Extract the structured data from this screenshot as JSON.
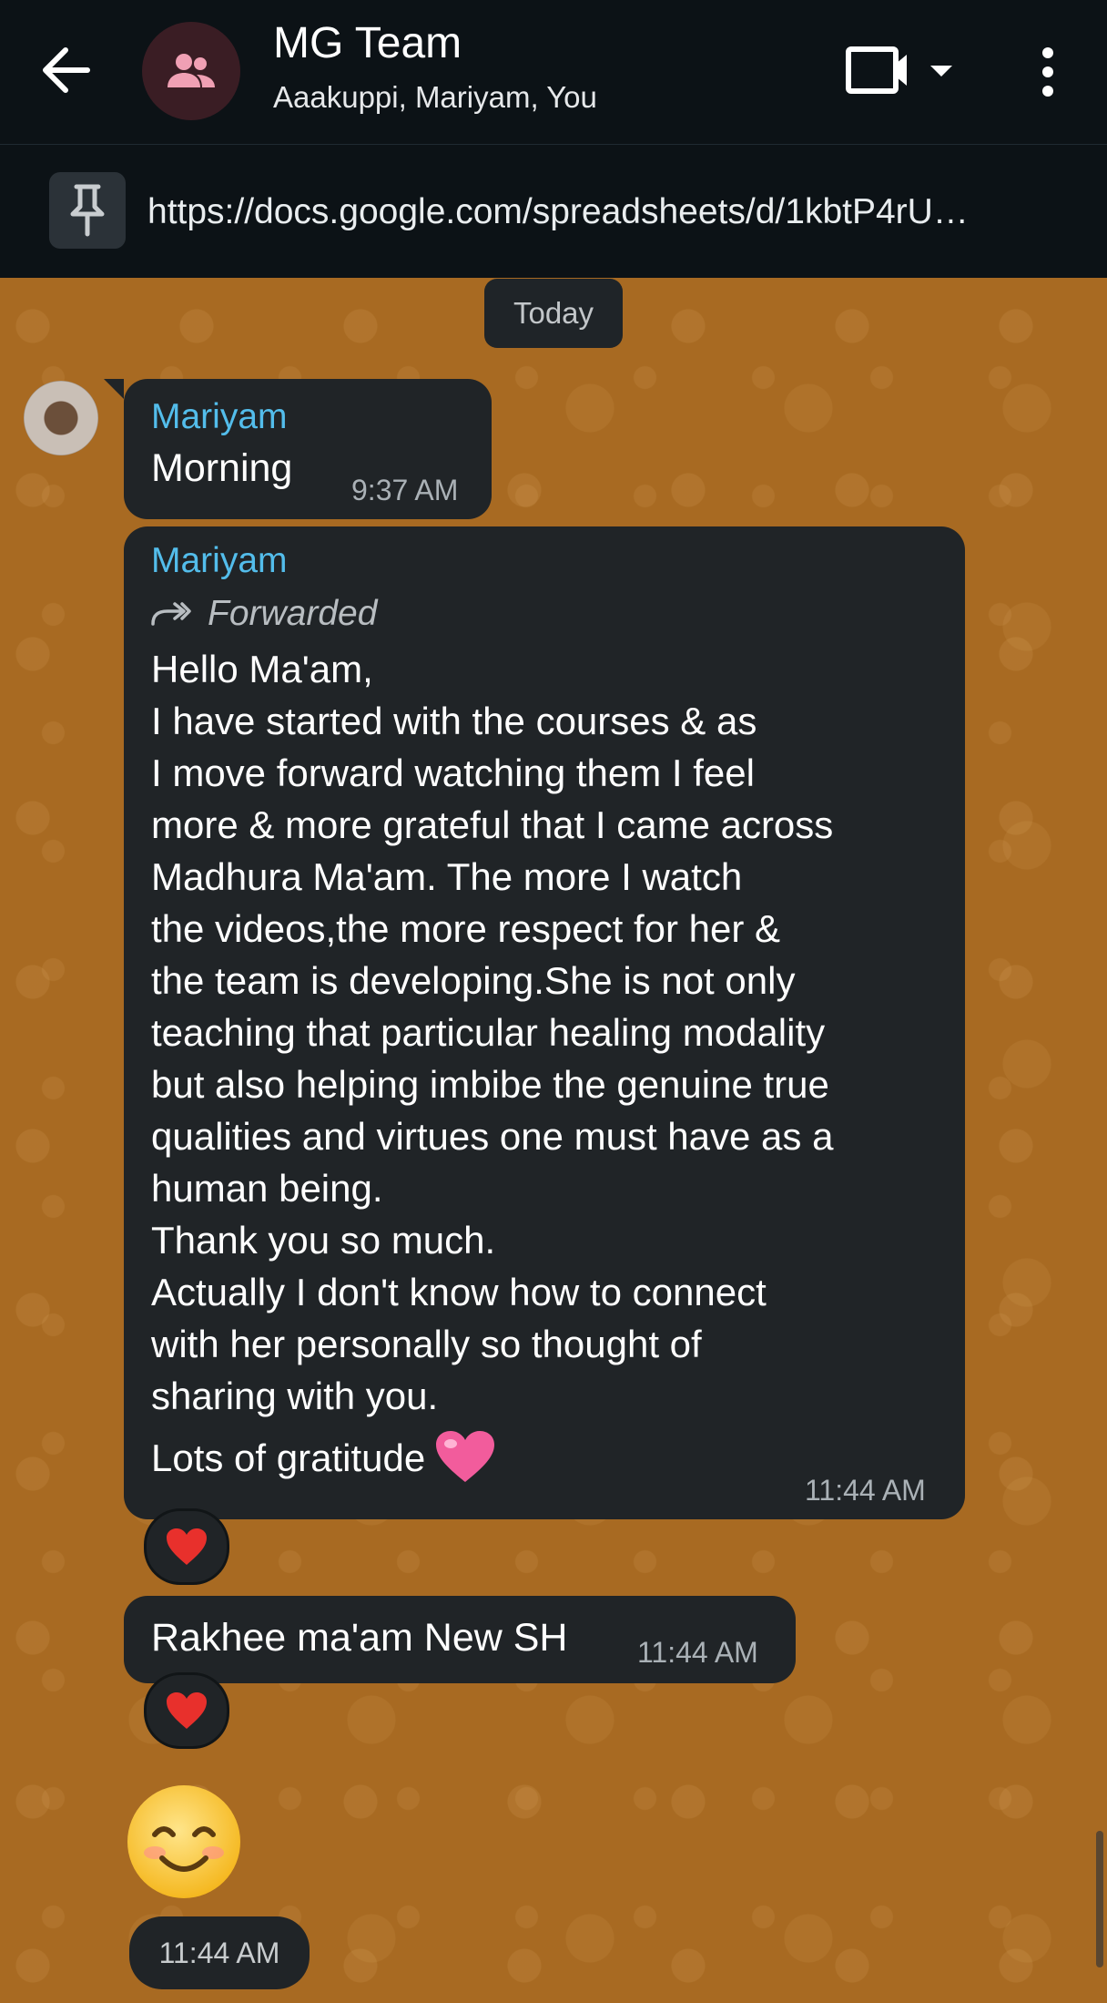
{
  "header": {
    "title": "MG Team",
    "subtitle": "Aaakuppi, Mariyam, You"
  },
  "pinned": {
    "text": "https://docs.google.com/spreadsheets/d/1kbtP4rU…"
  },
  "date_chip": "Today",
  "messages": [
    {
      "sender": "Mariyam",
      "text": "Morning",
      "time": "9:37 AM"
    },
    {
      "sender": "Mariyam",
      "forwarded_label": "Forwarded",
      "lines": [
        "Hello Ma'am,",
        "I have started with the courses & as",
        "I move forward watching them I feel",
        "more & more grateful that I came across",
        "Madhura Ma'am. The more I watch",
        "the videos,the more respect for her &",
        "the team is developing.She is not only",
        "teaching that particular healing modality",
        "but also helping imbibe the genuine true",
        "qualities and virtues one must have as a",
        "human being.",
        "Thank you so much.",
        "Actually I don't know how to connect",
        "with her personally so thought of",
        "sharing with you.",
        "Lots of gratitude"
      ],
      "time": "11:44 AM",
      "reaction": "red-heart"
    },
    {
      "text": "Rakhee ma'am New SH",
      "time": "11:44 AM",
      "reaction": "red-heart"
    },
    {
      "emoji": "smiling-face",
      "time": "11:44 AM"
    }
  ],
  "colors": {
    "header_bg": "#0c1216",
    "wallpaper": "#a86a22",
    "bubble": "#202427",
    "sender_name": "#53bdeb"
  }
}
